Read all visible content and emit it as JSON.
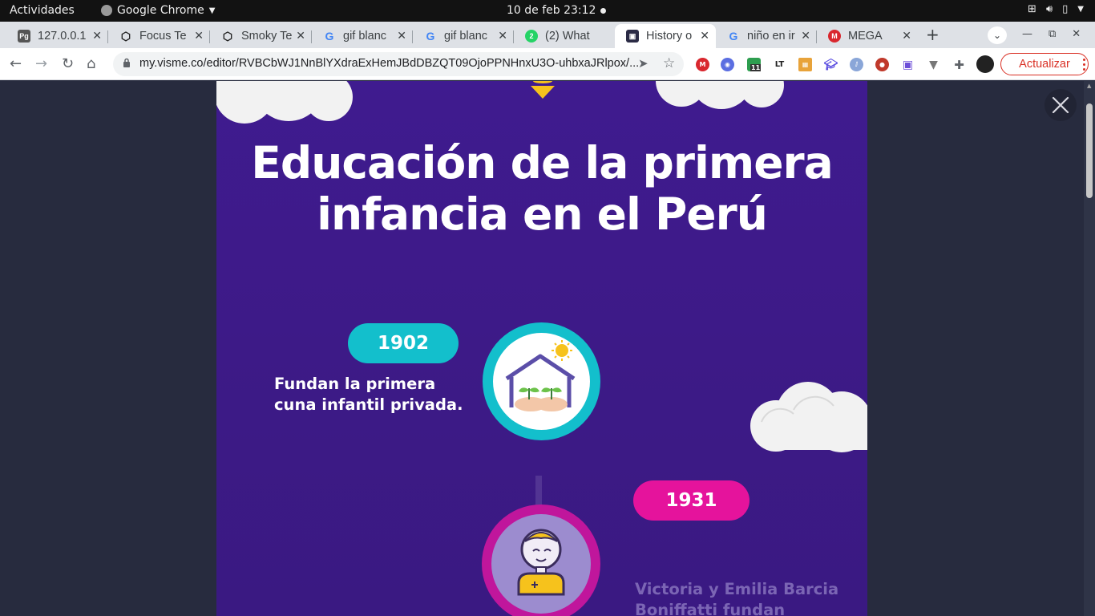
{
  "topbar": {
    "activities": "Actividades",
    "app_name": "Google Chrome",
    "clock": "10 de feb  23:12"
  },
  "tabs": [
    {
      "label": "127.0.0.1",
      "favicon": "pg-icon"
    },
    {
      "label": "Focus Te",
      "favicon": "focus-icon"
    },
    {
      "label": "Smoky Te",
      "favicon": "focus-icon"
    },
    {
      "label": "gif blanc",
      "favicon": "google-icon"
    },
    {
      "label": "gif blanc",
      "favicon": "google-icon"
    },
    {
      "label": "(2) What",
      "favicon": "whatsapp-icon",
      "badge": "2"
    },
    {
      "label": "History o",
      "favicon": "visme-icon",
      "active": true
    },
    {
      "label": "niño en ir",
      "favicon": "google-icon"
    },
    {
      "label": "MEGA",
      "favicon": "mega-icon"
    }
  ],
  "toolbar": {
    "url": "my.visme.co/editor/RVBCbWJ1NnBlYXdraExHemJBdDBZQT09OjoPPNHnxU3O-uhbxaJRlpox/...",
    "update_label": "Actualizar",
    "ext_badge": "11",
    "ext_lt": "LT"
  },
  "content": {
    "title": "Educación de la primera infancia en el Perú",
    "events": [
      {
        "year": "1902",
        "text": "Fundan la primera cuna infantil privada.",
        "color": "#13bfcc"
      },
      {
        "year": "1931",
        "text": "Victoria y Emilia Barcia Boniffatti fundan",
        "color": "#e5139c"
      }
    ]
  },
  "colors": {
    "canvas_bg": "#3f1b8f",
    "page_bg": "#272b3e",
    "cyan": "#13bfcc",
    "magenta": "#e5139c",
    "update_red": "#d93025"
  }
}
